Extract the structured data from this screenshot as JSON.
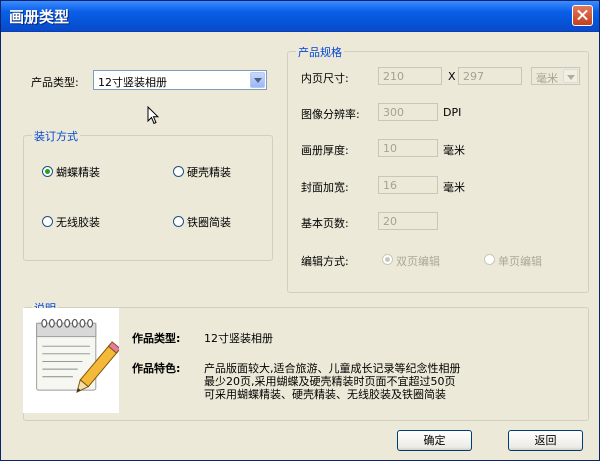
{
  "window": {
    "title": "画册类型"
  },
  "product_type": {
    "label": "产品类型:",
    "value": "12寸竖装相册"
  },
  "binding": {
    "legend": "装订方式",
    "options": [
      {
        "label": "蝴蝶精装",
        "selected": true
      },
      {
        "label": "硬壳精装",
        "selected": false
      },
      {
        "label": "无线胶装",
        "selected": false
      },
      {
        "label": "铁圈简装",
        "selected": false
      }
    ]
  },
  "spec": {
    "legend": "产品规格",
    "inner_size_label": "内页尺寸:",
    "width": "210",
    "times": "X",
    "height": "297",
    "unit": "毫米",
    "resolution_label": "图像分辨率:",
    "resolution": "300",
    "resolution_unit": "DPI",
    "thickness_label": "画册厚度:",
    "thickness": "10",
    "thickness_unit": "毫米",
    "cover_label": "封面加宽:",
    "cover": "16",
    "cover_unit": "毫米",
    "pages_label": "基本页数:",
    "pages": "20",
    "edit_label": "编辑方式:",
    "edit_double": "双页编辑",
    "edit_single": "单页编辑"
  },
  "desc": {
    "legend": "说明",
    "type_label": "作品类型:",
    "type_value": "12寸竖装相册",
    "feature_label": "作品特色:",
    "feature_line1": "产品版面较大,适合旅游、儿童成长记录等纪念性相册",
    "feature_line2": "最少20页,采用蝴蝶及硬壳精装时页面不宜超过50页",
    "feature_line3": "可采用蝴蝶精装、硬壳精装、无线胶装及铁圈简装"
  },
  "buttons": {
    "ok": "确定",
    "back": "返回"
  }
}
